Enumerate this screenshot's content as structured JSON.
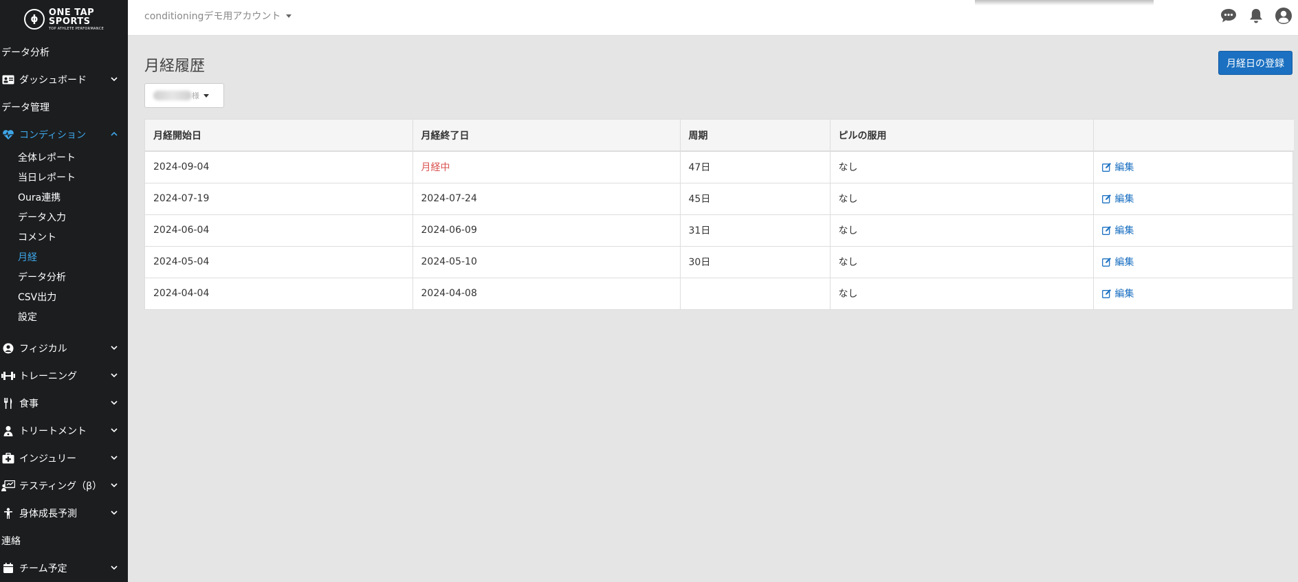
{
  "logo": {
    "line1": "ONE TAP",
    "line2": "SPORTS",
    "tagline": "TOP ATHLETE PERFORMANCE"
  },
  "header": {
    "team_name": "conditioningデモ用アカウント"
  },
  "sidebar": {
    "sections": {
      "data_analysis": "データ分析",
      "data_management": "データ管理",
      "contact": "連絡"
    },
    "dashboard": "ダッシュボード",
    "condition": {
      "label": "コンディション",
      "items": [
        "全体レポート",
        "当日レポート",
        "Oura連携",
        "データ入力",
        "コメント",
        "月経",
        "データ分析",
        "CSV出力",
        "設定"
      ]
    },
    "groups": [
      "フィジカル",
      "トレーニング",
      "食事",
      "トリートメント",
      "インジュリー",
      "テスティング（β）",
      "身体成長予測"
    ],
    "last_partial": "チーム予定"
  },
  "main": {
    "title": "月経履歴",
    "register_button": "月経日の登録",
    "athlete_suffix": "様",
    "table": {
      "headers": [
        "月経開始日",
        "月経終了日",
        "周期",
        "ピルの服用",
        ""
      ],
      "edit_label": "編集",
      "rows": [
        {
          "start": "2024-09-04",
          "end": "月経中",
          "cycle": "47日",
          "pill": "なし"
        },
        {
          "start": "2024-07-19",
          "end": "2024-07-24",
          "cycle": "45日",
          "pill": "なし"
        },
        {
          "start": "2024-06-04",
          "end": "2024-06-09",
          "cycle": "31日",
          "pill": "なし"
        },
        {
          "start": "2024-05-04",
          "end": "2024-05-10",
          "cycle": "30日",
          "pill": "なし"
        },
        {
          "start": "2024-04-04",
          "end": "2024-04-08",
          "cycle": "",
          "pill": "なし"
        }
      ]
    }
  },
  "colors": {
    "accent": "#3ea6e8",
    "primary_button": "#1b70c1",
    "ongoing": "#d9534f",
    "sidebar_bg": "#1b1d1f"
  }
}
